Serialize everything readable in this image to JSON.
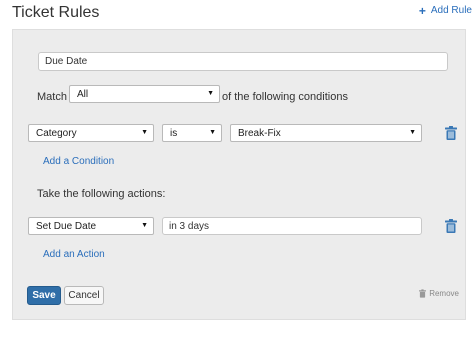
{
  "header": {
    "title": "Ticket Rules",
    "add_rule_label": "Add Rule",
    "add_rule_icon": "plus-icon"
  },
  "rule": {
    "name_value": "Due Date",
    "match_label": "Match",
    "match_value": "All",
    "match_suffix": "of the following conditions",
    "condition": {
      "field": "Category",
      "operator": "is",
      "value": "Break-Fix"
    },
    "add_condition_label": "Add a Condition",
    "actions_heading": "Take the following actions:",
    "action": {
      "type": "Set Due Date",
      "value": "in 3 days"
    },
    "add_action_label": "Add an Action",
    "save_label": "Save",
    "cancel_label": "Cancel",
    "remove_label": "Remove"
  },
  "colors": {
    "accent": "#2a6ebb",
    "save_button": "#2f6ea8",
    "panel_bg": "#ececec",
    "trash": "#3a78b5"
  }
}
